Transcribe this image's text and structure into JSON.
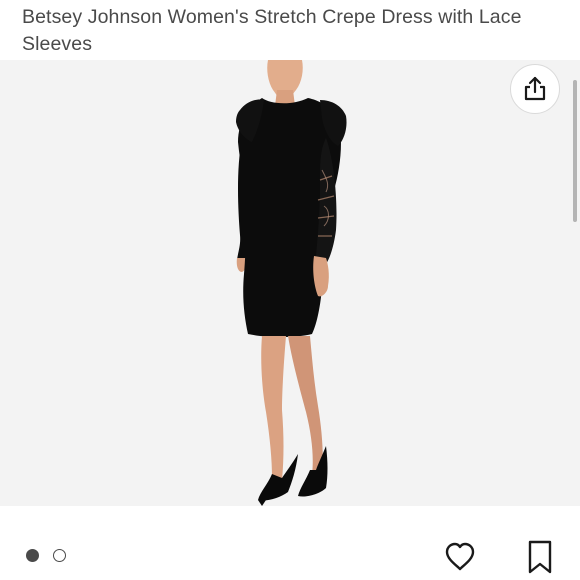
{
  "listing": {
    "title": "Betsey Johnson Women's Stretch Crepe Dress with Lace Sleeves"
  },
  "gallery": {
    "image_count": 2,
    "active_index": 0,
    "background_color": "#f3f3f3"
  },
  "icons": {
    "share": "share-icon",
    "like": "heart-icon",
    "save": "bookmark-icon"
  },
  "colors": {
    "title_text": "#4a4a4a",
    "icon": "#1a1a1a",
    "dress": "#0c0c0c"
  }
}
